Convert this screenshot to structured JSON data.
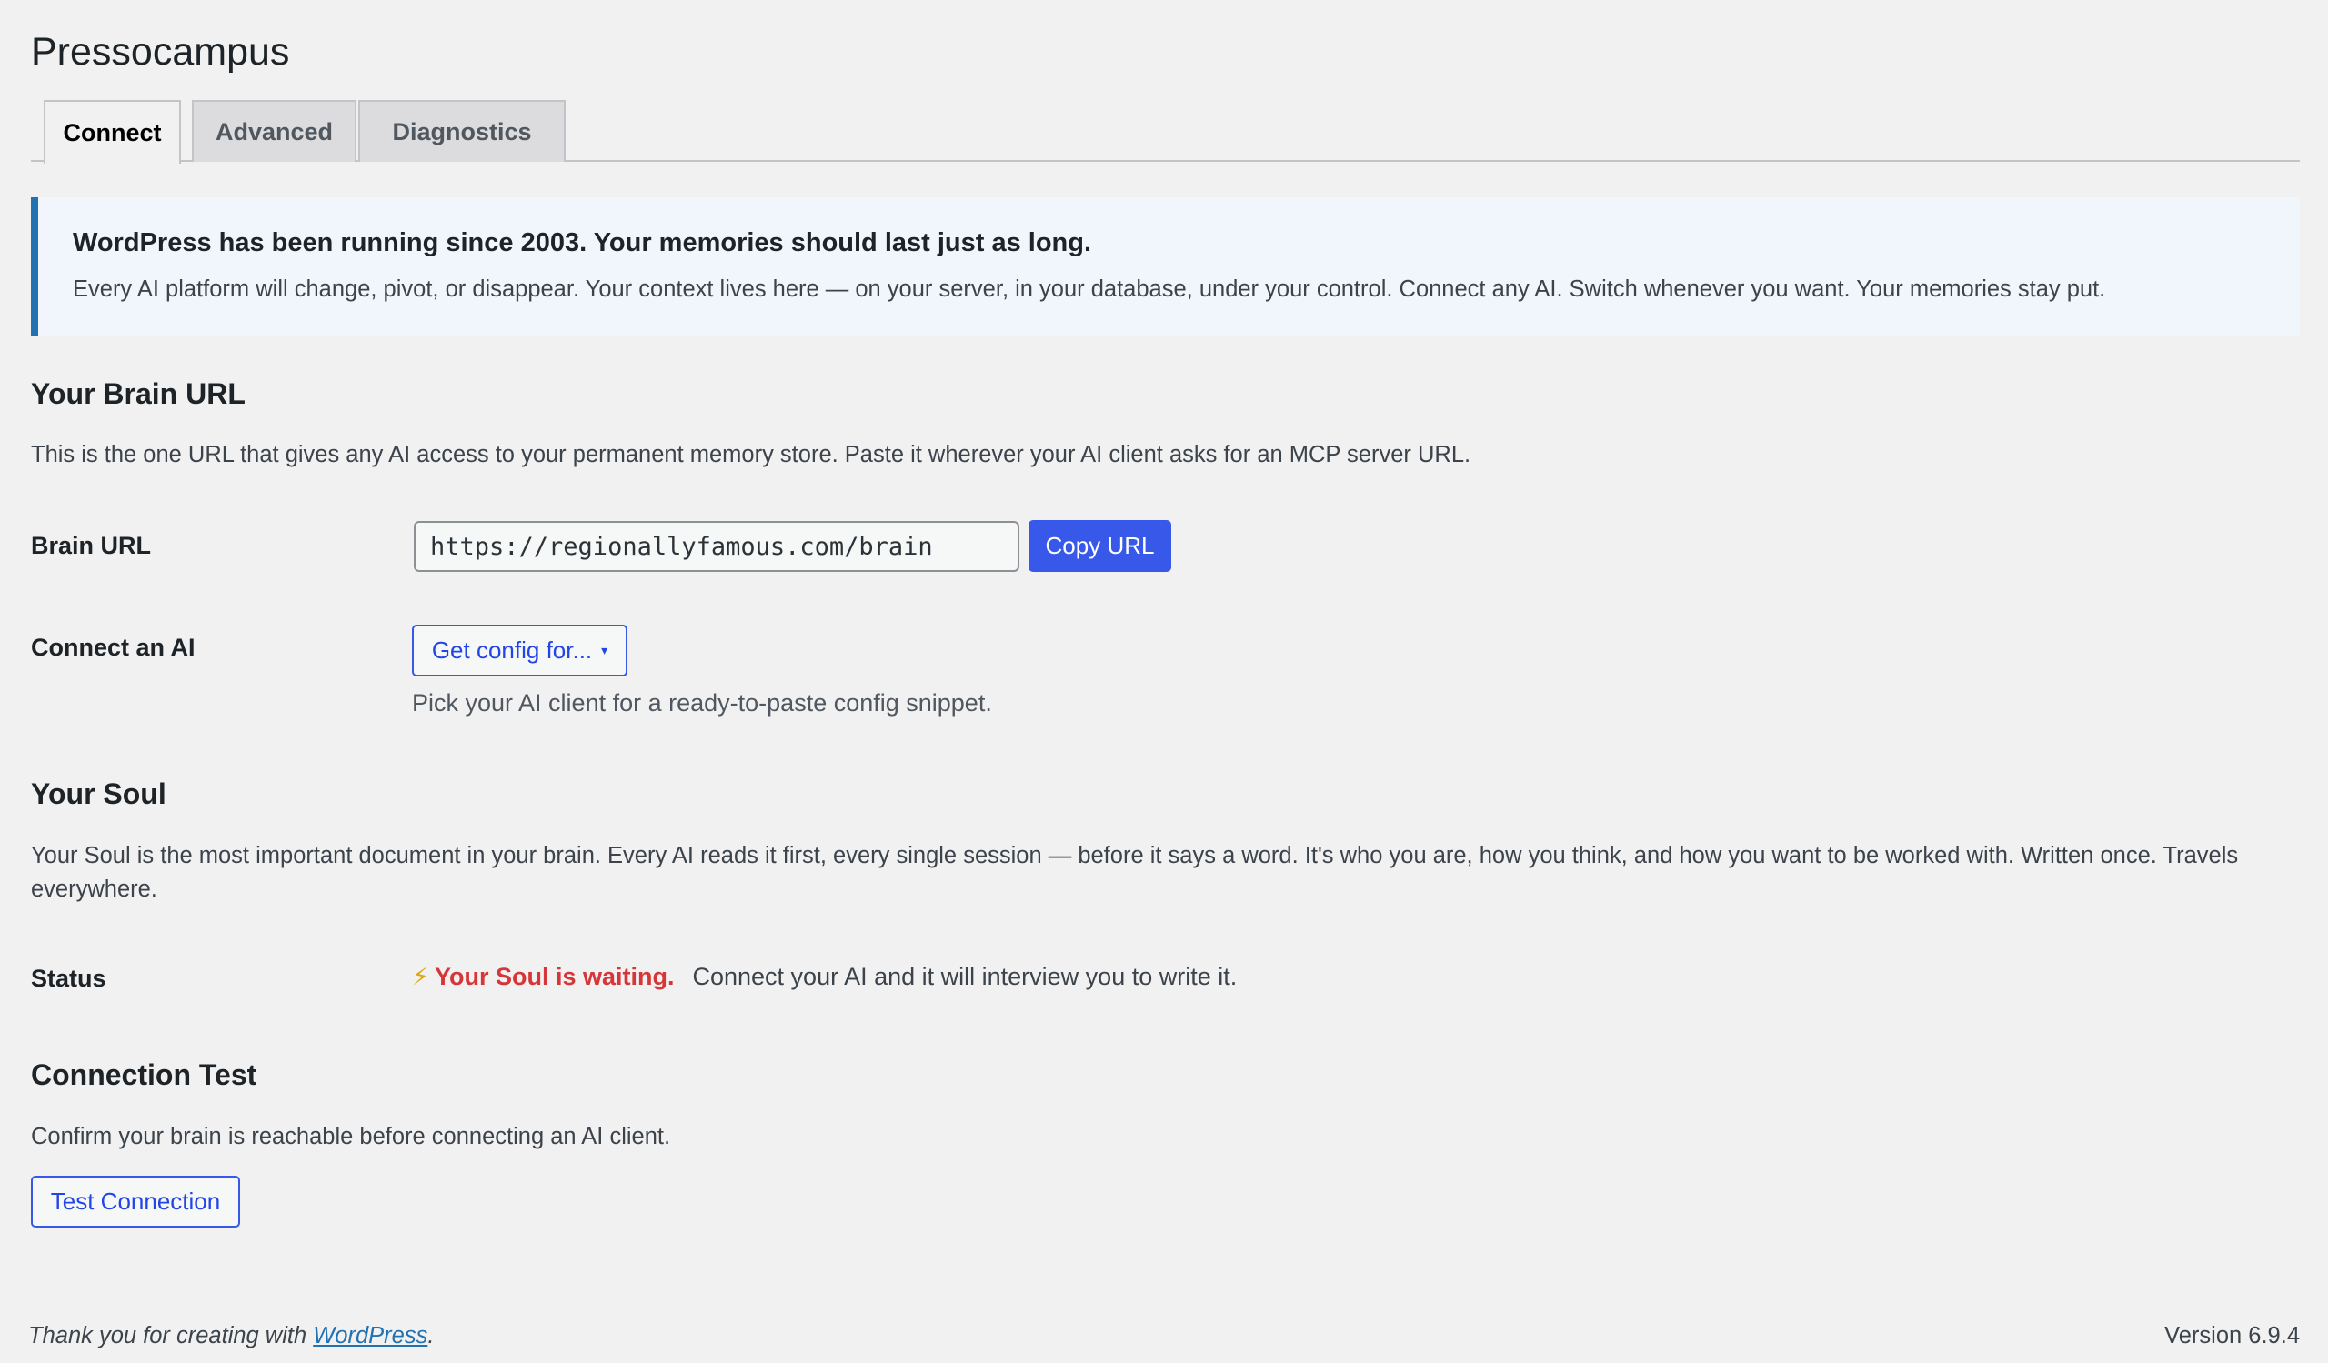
{
  "page": {
    "title": "Pressocampus"
  },
  "tabs": [
    {
      "label": "Connect",
      "active": true
    },
    {
      "label": "Advanced",
      "active": false
    },
    {
      "label": "Diagnostics",
      "active": false
    }
  ],
  "notice": {
    "title": "WordPress has been running since 2003. Your memories should last just as long.",
    "body": "Every AI platform will change, pivot, or disappear. Your context lives here — on your server, in your database, under your control. Connect any AI. Switch whenever you want. Your memories stay put."
  },
  "brain_url": {
    "heading": "Your Brain URL",
    "description": "This is the one URL that gives any AI access to your permanent memory store. Paste it wherever your AI client asks for an MCP server URL.",
    "field_label": "Brain URL",
    "value": "https://regionallyfamous.com/brain",
    "copy_button": "Copy URL"
  },
  "connect_ai": {
    "label": "Connect an AI",
    "button": "Get config for...",
    "caret_icon": "▾",
    "hint": "Pick your AI client for a ready-to-paste config snippet."
  },
  "soul": {
    "heading": "Your Soul",
    "description": "Your Soul is the most important document in your brain. Every AI reads it first, every single session — before it says a word. It's who you are, how you think, and how you want to be worked with. Written once. Travels everywhere.",
    "status_label": "Status",
    "status_icon": "⚡",
    "status_strong": "Your Soul is waiting.",
    "status_text": "Connect your AI and it will interview you to write it."
  },
  "connection_test": {
    "heading": "Connection Test",
    "description": "Confirm your brain is reachable before connecting an AI client.",
    "button": "Test Connection"
  },
  "footer": {
    "thanks_prefix": "Thank you for creating with ",
    "link": "WordPress",
    "thanks_suffix": ".",
    "version": "Version 6.9.4"
  },
  "colors": {
    "accent": "#3858e9",
    "notice_border": "#2271b1",
    "status_red": "#d63638",
    "bolt": "#dba617"
  }
}
